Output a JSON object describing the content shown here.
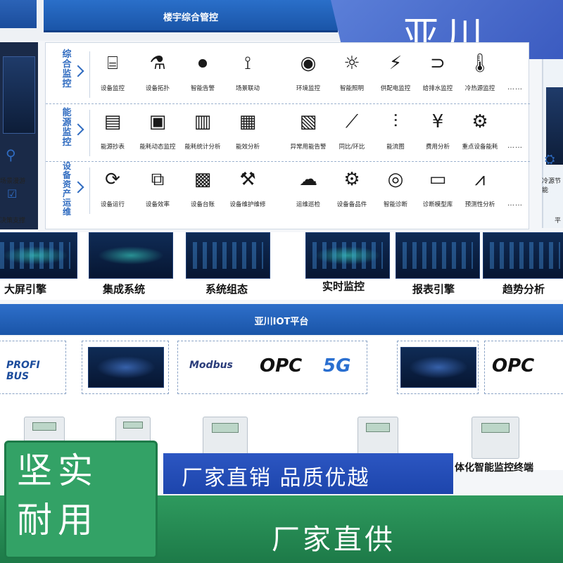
{
  "brand": {
    "name": "亚川"
  },
  "header": {
    "title": "楼宇综合管控"
  },
  "left_side": {
    "label_1": "场景漫游",
    "label_2": "决策支撑"
  },
  "right_side": {
    "label_1": "冷源节能",
    "label_2": "平"
  },
  "rows": [
    {
      "category": "综合监控",
      "items": [
        {
          "label": "设备监控",
          "icon": "router-icon"
        },
        {
          "label": "设备拓扑",
          "icon": "network-icon"
        },
        {
          "label": "智能告警",
          "icon": "alarm-icon"
        },
        {
          "label": "场景联动",
          "icon": "link-icon"
        },
        {
          "label": "环境监控",
          "icon": "camera-icon"
        },
        {
          "label": "智能照明",
          "icon": "bulb-icon"
        },
        {
          "label": "供配电监控",
          "icon": "power-icon"
        },
        {
          "label": "给排水监控",
          "icon": "pipe-icon"
        },
        {
          "label": "冷热源监控",
          "icon": "thermometer-icon"
        }
      ],
      "more": "……"
    },
    {
      "category": "能源监控",
      "items": [
        {
          "label": "能源抄表",
          "icon": "report-icon"
        },
        {
          "label": "能耗动态监控",
          "icon": "monitor-icon"
        },
        {
          "label": "能耗统计分析",
          "icon": "stats-icon"
        },
        {
          "label": "能效分析",
          "icon": "chart-icon"
        },
        {
          "label": "异常用能告警",
          "icon": "doc-alert-icon"
        },
        {
          "label": "同比/环比",
          "icon": "trend-icon"
        },
        {
          "label": "能流图",
          "icon": "flow-icon"
        },
        {
          "label": "费用分析",
          "icon": "yen-icon"
        },
        {
          "label": "重点设备能耗",
          "icon": "gear-icon"
        }
      ],
      "more": "……"
    },
    {
      "category": "设备资产运维",
      "items": [
        {
          "label": "设备运行",
          "icon": "cycle-icon"
        },
        {
          "label": "设备效率",
          "icon": "efficiency-icon"
        },
        {
          "label": "设备台账",
          "icon": "ledger-icon"
        },
        {
          "label": "设备维护维修",
          "icon": "wrench-icon"
        },
        {
          "label": "运维巡检",
          "icon": "cloud-icon"
        },
        {
          "label": "设备备品件",
          "icon": "parts-icon"
        },
        {
          "label": "智能诊断",
          "icon": "diagnose-icon"
        },
        {
          "label": "诊断模型库",
          "icon": "library-icon"
        },
        {
          "label": "预测性分析",
          "icon": "predict-icon"
        }
      ],
      "more": "……"
    }
  ],
  "screens": [
    {
      "label": "大屏引擎"
    },
    {
      "label": "集成系统"
    },
    {
      "label": "系统组态"
    },
    {
      "label": "实时监控"
    },
    {
      "label": "报表引擎"
    },
    {
      "label": "趋势分析"
    }
  ],
  "iot": {
    "title": "亚川IOT平台"
  },
  "protocols": {
    "profibus": "PROFI BUS",
    "modbus": "Modbus",
    "opc": "OPC",
    "fiveg": "5G",
    "opc2": "OPC"
  },
  "device_terminal_label": "体化智能监控终端",
  "banners": {
    "quality_box": "坚实耐用",
    "blue_bar": "厂家直销  品质优越",
    "supply": "厂家直供"
  }
}
